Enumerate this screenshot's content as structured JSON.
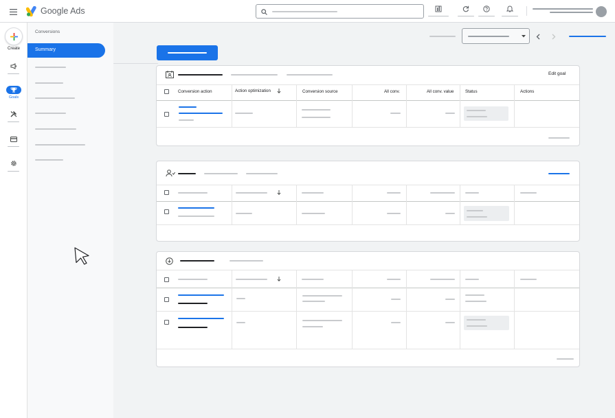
{
  "app": {
    "brand": "Google Ads"
  },
  "rail": {
    "create_label": "Create",
    "goals_label": "Goals"
  },
  "nav": {
    "section_label": "Conversions",
    "active_item": "Summary"
  },
  "table1": {
    "edit_goal": "Edit goal",
    "headers": [
      "Conversion action",
      "Action optimization",
      "Conversion source",
      "All conv.",
      "All conv. value",
      "Status",
      "Actions"
    ]
  },
  "icons": {
    "menu": "menu-icon",
    "logo": "google-ads-logo-icon",
    "search": "search-icon",
    "reports": "reports-icon",
    "refresh": "refresh-icon",
    "help": "help-icon",
    "notifications": "bell-icon",
    "account": "avatar-icon",
    "campaigns": "megaphone-icon",
    "goals": "trophy-icon",
    "tools": "tools-icon",
    "billing": "billing-card-icon",
    "settings": "gear-icon",
    "sort": "arrow-down-icon",
    "cursor": "mouse-pointer-icon"
  },
  "colors": {
    "accent": "#1a73e8",
    "background": "#f1f3f4"
  }
}
